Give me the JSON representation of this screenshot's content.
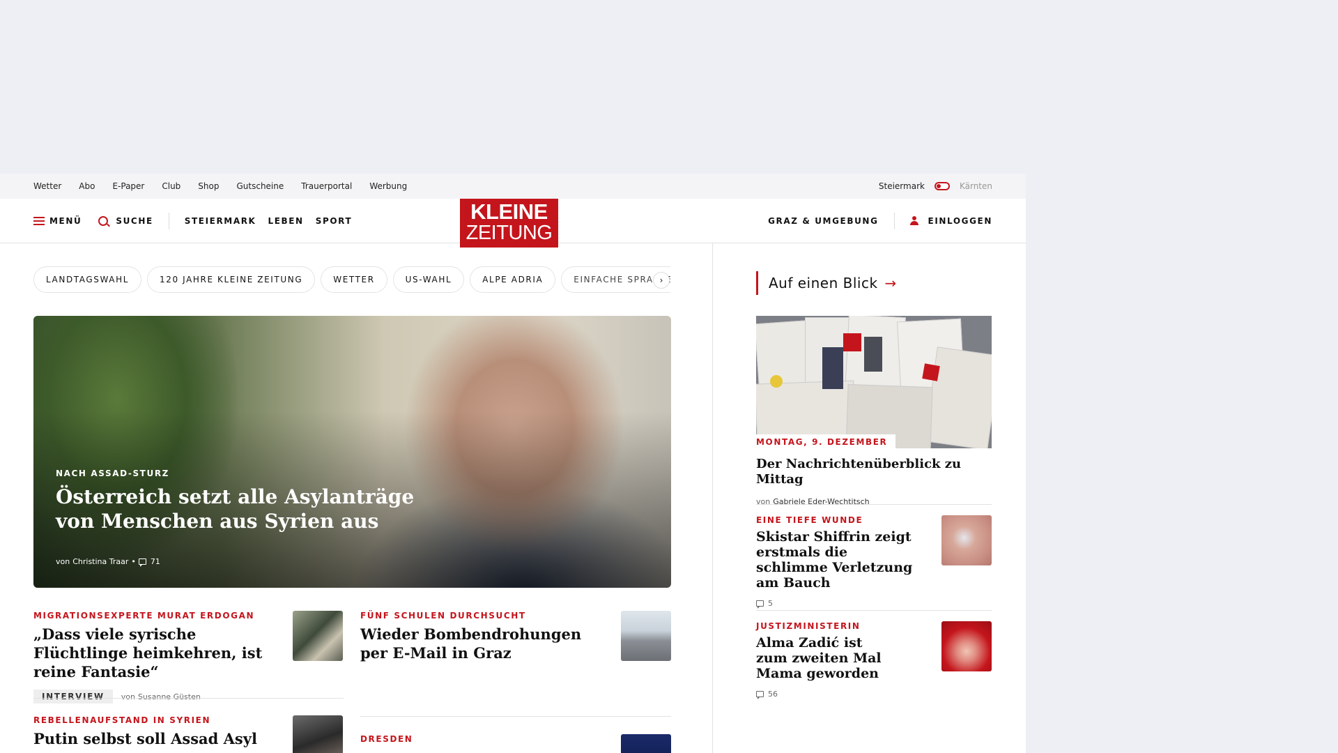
{
  "utility_bar": {
    "links": [
      "Wetter",
      "Abo",
      "E-Paper",
      "Club",
      "Shop",
      "Gutscheine",
      "Trauerportal",
      "Werbung"
    ],
    "region_active": "Steiermark",
    "region_inactive": "Kärnten"
  },
  "header": {
    "menu_label": "MENÜ",
    "search_label": "SUCHE",
    "nav": [
      "STEIERMARK",
      "LEBEN",
      "SPORT"
    ],
    "logo_line1": "KLEINE",
    "logo_line2": "ZEITUNG",
    "local_label": "GRAZ & UMGEBUNG",
    "login_label": "EINLOGGEN"
  },
  "topics": [
    "LANDTAGSWAHL",
    "120 JAHRE KLEINE ZEITUNG",
    "WETTER",
    "US-WAHL",
    "ALPE ADRIA",
    "EINFACHE SPRACHE"
  ],
  "hero": {
    "kicker": "NACH ASSAD-STURZ",
    "title": "Österreich setzt alle Asylanträge von Menschen aus Syrien aus",
    "by": "von",
    "author": "Christina Traar",
    "comments": "71"
  },
  "articles": [
    {
      "kicker": "MIGRATIONSEXPERTE MURAT ERDOGAN",
      "title": "„Dass viele syrische Flüchtlinge heimkehren, ist reine Fantasie“",
      "tag": "INTERVIEW",
      "by": "von",
      "author": "Susanne Güsten"
    },
    {
      "kicker": "FÜNF SCHULEN DURCHSUCHT",
      "title": "Wieder Bombendrohungen per E-Mail in Graz"
    },
    {
      "kicker": "REBELLENAUFSTAND IN SYRIEN",
      "title": "Putin selbst soll Assad Asyl"
    },
    {
      "kicker": "DRESDEN",
      "title": ""
    }
  ],
  "sidebar": {
    "heading": "Auf einen Blick",
    "main": {
      "date": "MONTAG, 9. DEZEMBER",
      "title": "Der Nachrichtenüberblick zu Mittag",
      "by": "von",
      "author": "Gabriele Eder-Wechtitsch"
    },
    "items": [
      {
        "kicker": "EINE TIEFE WUNDE",
        "title": "Skistar Shiffrin zeigt erstmals die schlimme Verletzung am Bauch",
        "comments": "5"
      },
      {
        "kicker": "JUSTIZMINISTERIN",
        "title": "Alma Zadić ist zum zweiten Mal Mama geworden",
        "comments": "56"
      }
    ]
  },
  "colors": {
    "accent": "#c4151c",
    "page_bg": "#eeeff4",
    "utility_bg": "#f4f4f6"
  }
}
